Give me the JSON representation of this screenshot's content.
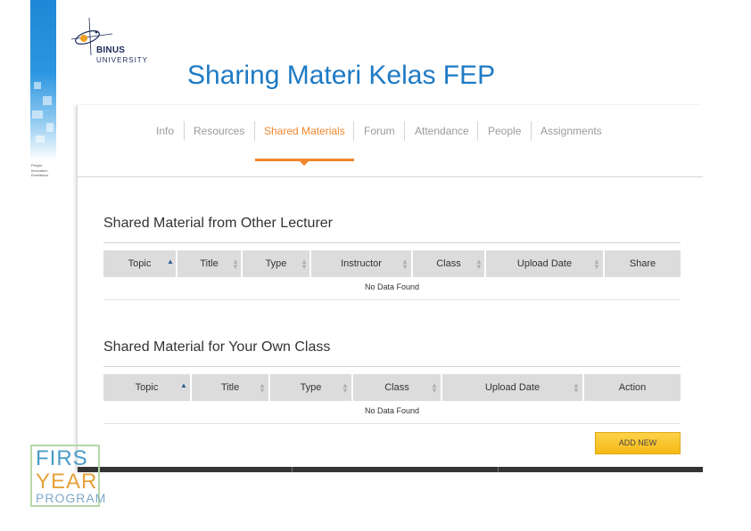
{
  "slide": {
    "title": "Sharing Materi Kelas FEP",
    "tagline": [
      "People",
      "Innovation",
      "Excellence"
    ],
    "logo": {
      "name": "BINUS",
      "subtitle": "UNIVERSITY"
    },
    "program_logo": {
      "line1": "FIRS",
      "line2": "YEAR",
      "line3": "PROGRAM"
    }
  },
  "tabs": [
    {
      "label": "Info"
    },
    {
      "label": "Resources"
    },
    {
      "label": "Shared Materials"
    },
    {
      "label": "Forum"
    },
    {
      "label": "Attendance"
    },
    {
      "label": "People"
    },
    {
      "label": "Assignments"
    }
  ],
  "active_tab": "Shared Materials",
  "section1": {
    "title": "Shared Material from Other Lecturer",
    "columns": [
      "Topic",
      "Title",
      "Type",
      "Instructor",
      "Class",
      "Upload Date",
      "Share"
    ],
    "empty_text": "No Data Found"
  },
  "section2": {
    "title": "Shared Material for Your Own Class",
    "columns": [
      "Topic",
      "Title",
      "Type",
      "Class",
      "Upload Date",
      "Action"
    ],
    "empty_text": "No Data Found",
    "add_button": "ADD NEW"
  },
  "colors": {
    "accent": "#f0872e",
    "title_blue": "#1e7ac4",
    "header_bg": "#dcdcdc",
    "button_yellow": "#f5b915"
  }
}
